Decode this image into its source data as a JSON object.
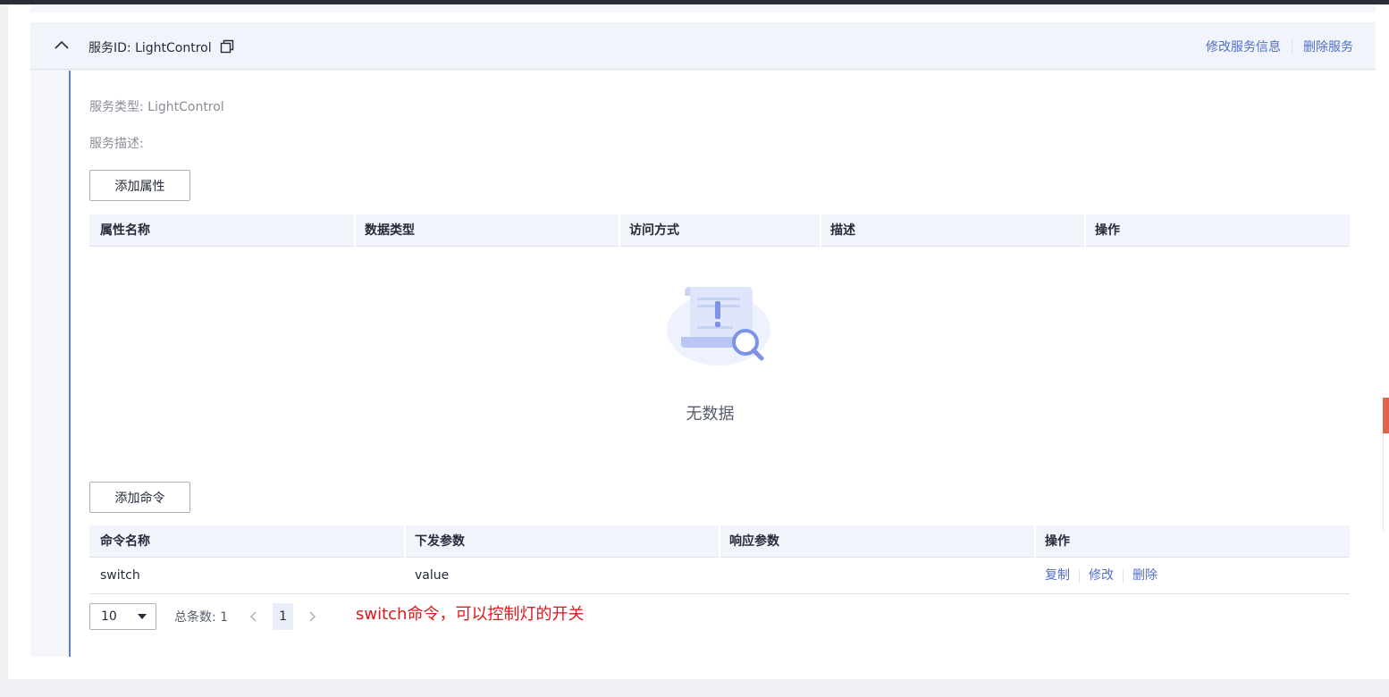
{
  "service": {
    "id_label": "服务ID: LightControl",
    "actions": {
      "edit": "修改服务信息",
      "delete": "删除服务"
    },
    "type_label": "服务类型: LightControl",
    "desc_label": "服务描述:"
  },
  "properties": {
    "add_button": "添加属性",
    "columns": [
      "属性名称",
      "数据类型",
      "访问方式",
      "描述",
      "操作"
    ],
    "empty_text": "无数据"
  },
  "commands": {
    "add_button": "添加命令",
    "columns": [
      "命令名称",
      "下发参数",
      "响应参数",
      "操作"
    ],
    "rows": [
      {
        "name": "switch",
        "params": "value",
        "response": "",
        "ops": [
          "复制",
          "修改",
          "删除"
        ]
      }
    ]
  },
  "pagination": {
    "page_size": "10",
    "total": "总条数: 1",
    "current_page": "1"
  },
  "annotation": "switch命令，可以控制灯的开关",
  "colors": {
    "link": "#526ecc",
    "accent_border": "#5e7ce0",
    "annotation": "#e0171b",
    "header_bg": "#f1f4fa"
  },
  "icons": {
    "collapse": "chevron-up-icon",
    "copy": "copy-icon",
    "empty": "empty-document-search-icon",
    "dropdown": "caret-down-icon",
    "prev": "chevron-left-icon",
    "next": "chevron-right-icon"
  }
}
